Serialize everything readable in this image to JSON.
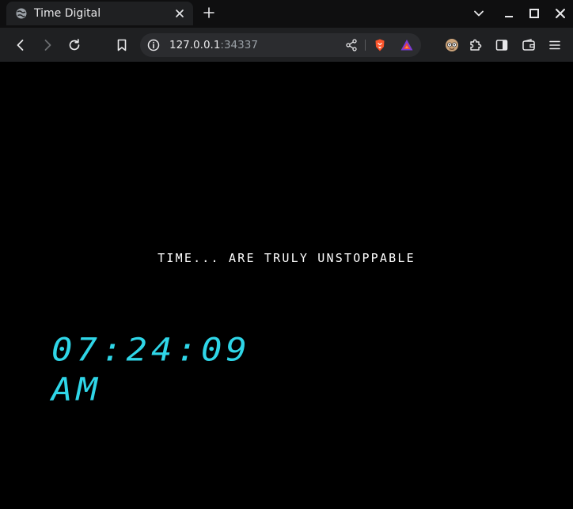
{
  "browser": {
    "tab": {
      "title": "Time Digital"
    },
    "address": {
      "host": "127.0.0.1",
      "port": ":34337"
    }
  },
  "page": {
    "tagline": "TIME... ARE TRULY UNSTOPPABLE",
    "clock": {
      "time": "07:24:09",
      "period": "AM",
      "color": "#2fd6e8"
    }
  }
}
